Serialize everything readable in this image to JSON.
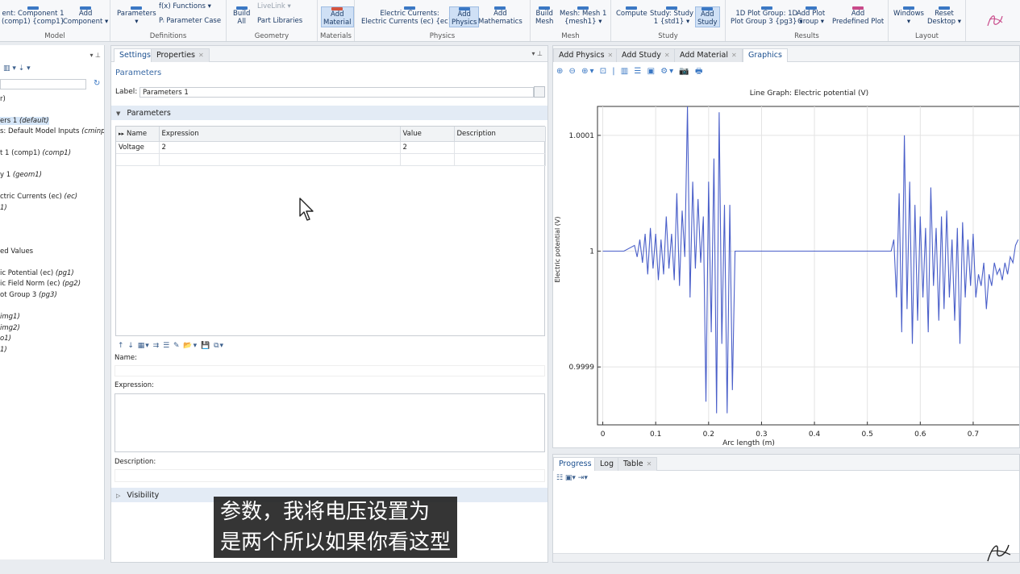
{
  "ribbon": {
    "groups": [
      {
        "title": "Model",
        "buttons": [
          "ent: Component 1\n(comp1) {comp1}",
          "Add\nComponent ▾"
        ]
      },
      {
        "title": "Definitions",
        "buttons": [
          "Parameters\n▾",
          "f(x) Functions ▾",
          "Pᵢ Parameter Case"
        ]
      },
      {
        "title": "Geometry",
        "buttons": [
          "Build\nAll",
          "LiveLink ▾",
          "Part Libraries"
        ]
      },
      {
        "title": "Materials",
        "buttons": [
          "Add\nMaterial"
        ]
      },
      {
        "title": "Physics",
        "buttons": [
          "Electric Currents:\nElectric Currents (ec) {ec} ▾",
          "Add\nPhysics",
          "Add\nMathematics"
        ]
      },
      {
        "title": "Mesh",
        "buttons": [
          "Build\nMesh",
          "Mesh: Mesh 1\n{mesh1} ▾"
        ]
      },
      {
        "title": "Study",
        "buttons": [
          "Compute",
          "Study: Study\n1 {std1} ▾",
          "Add\nStudy"
        ]
      },
      {
        "title": "Results",
        "buttons": [
          "1D Plot Group: 1D\nPlot Group 3 {pg3} ▾",
          "Add Plot\nGroup ▾",
          "Add\nPredefined Plot"
        ]
      },
      {
        "title": "Layout",
        "buttons": [
          "Windows\n▾",
          "Reset\nDesktop ▾"
        ]
      }
    ]
  },
  "tree": {
    "tools": "▥ ▾  ⇣ ▾",
    "items": [
      {
        "text": "r)",
        "italic": "",
        "selected": false
      },
      {
        "text": "ers 1 ",
        "italic": "(default)",
        "selected": true
      },
      {
        "text": "s: Default Model Inputs ",
        "italic": "(cminpt)",
        "selected": false
      },
      {
        "text": "t 1 (comp1) ",
        "italic": "(comp1)",
        "selected": false
      },
      {
        "text": "y 1 ",
        "italic": "(geom1)",
        "selected": false
      },
      {
        "text": "ctric Currents (ec) ",
        "italic": "(ec)",
        "selected": false
      },
      {
        "text": "",
        "italic": "1)",
        "selected": false
      },
      {
        "text": "ed Values",
        "italic": "",
        "selected": false
      },
      {
        "text": "ic Potential (ec) ",
        "italic": "(pg1)",
        "selected": false
      },
      {
        "text": "ic Field Norm (ec) ",
        "italic": "(pg2)",
        "selected": false
      },
      {
        "text": "ot Group 3 ",
        "italic": "(pg3)",
        "selected": false
      },
      {
        "text": "",
        "italic": "img1)",
        "selected": false
      },
      {
        "text": "",
        "italic": "img2)",
        "selected": false
      },
      {
        "text": "",
        "italic": "o1)",
        "selected": false
      },
      {
        "text": "",
        "italic": "1)",
        "selected": false
      }
    ]
  },
  "settings": {
    "tabs": [
      {
        "label": "Settings",
        "active": true
      },
      {
        "label": "Properties",
        "active": false
      }
    ],
    "title": "Parameters",
    "label_caption": "Label:",
    "label_value": "Parameters 1",
    "section_parameters": "Parameters",
    "table": {
      "columns": [
        "Name",
        "Expression",
        "Value",
        "Description"
      ],
      "rows": [
        [
          "Voltage",
          "2",
          "2",
          ""
        ],
        [
          "",
          "",
          "",
          ""
        ]
      ]
    },
    "table_tools": "↑ ↓ ▦▾ ⇉ ☰ ✎ 📂▾ 💾 ⧉▾",
    "name_caption": "Name:",
    "expression_caption": "Expression:",
    "description_caption": "Description:",
    "section_visibility": "Visibility"
  },
  "graphics": {
    "tabs": [
      {
        "label": "Add Physics",
        "active": false
      },
      {
        "label": "Add Study",
        "active": false
      },
      {
        "label": "Add Material",
        "active": false
      },
      {
        "label": "Graphics",
        "active": true
      }
    ],
    "toolbar": "⊕ ⊖ ⊕▾ ⊡ | ▥ ☰ ▣ ⚙▾ 📷 🖶"
  },
  "progress": {
    "tabs": [
      {
        "label": "Progress",
        "active": true
      },
      {
        "label": "Log",
        "active": false
      },
      {
        "label": "Table",
        "active": false
      }
    ],
    "toolbar": "☷ ▣▾  ⇥▾"
  },
  "subtitle": {
    "line1": "参数，我将电压设置为",
    "line2": "是两个所以如果你看这型"
  },
  "colors": {
    "accent": "#3b78c4",
    "line": "#4a5fc9",
    "ribbon_bg": "#f7f8fa",
    "selection": "#d6e6f8"
  },
  "chart_data": {
    "type": "line",
    "title": "Line Graph: Electric potential (V)",
    "xlabel": "Arc length (m)",
    "ylabel": "Electric potential (V)",
    "xlim": [
      -0.01,
      0.79
    ],
    "ylim": [
      0.99985,
      1.000125
    ],
    "x_ticks": [
      0,
      0.1,
      0.2,
      0.3,
      0.4,
      0.5,
      0.6,
      0.7
    ],
    "x_tick_labels": [
      "0",
      "0.1",
      "0.2",
      "0.3",
      "0.4",
      "0.5",
      "0.6",
      "0.7"
    ],
    "y_ticks": [
      0.9999,
      1,
      1.0001
    ],
    "y_tick_labels": [
      "0.9999",
      "1",
      "1.0001"
    ],
    "grid": true,
    "series": [
      {
        "x": [
          0,
          0.04,
          0.06,
          0.065,
          0.07,
          0.075,
          0.08,
          0.085,
          0.09,
          0.095,
          0.1,
          0.105,
          0.11,
          0.115,
          0.12,
          0.125,
          0.13,
          0.135,
          0.14,
          0.145,
          0.15,
          0.155,
          0.16,
          0.165,
          0.17,
          0.175,
          0.18,
          0.185,
          0.19,
          0.195,
          0.2,
          0.205,
          0.21,
          0.215,
          0.22,
          0.225,
          0.23,
          0.235,
          0.24,
          0.245,
          0.25,
          0.3,
          0.4,
          0.5,
          0.545,
          0.55,
          0.555,
          0.56,
          0.565,
          0.57,
          0.575,
          0.58,
          0.585,
          0.59,
          0.595,
          0.6,
          0.605,
          0.61,
          0.615,
          0.62,
          0.625,
          0.63,
          0.635,
          0.64,
          0.645,
          0.65,
          0.655,
          0.66,
          0.665,
          0.67,
          0.675,
          0.68,
          0.685,
          0.69,
          0.695,
          0.7,
          0.705,
          0.71,
          0.715,
          0.72,
          0.725,
          0.73,
          0.735,
          0.74,
          0.745,
          0.75,
          0.755,
          0.76,
          0.765,
          0.77,
          0.775,
          0.78,
          0.785
        ],
        "y": [
          1.0,
          1.0,
          1.000005,
          0.999995,
          1.00001,
          0.99999,
          1.000015,
          0.99998,
          1.00002,
          0.999985,
          1.000015,
          0.999975,
          1.00001,
          0.99998,
          1.00003,
          0.999985,
          1.000015,
          0.999975,
          1.00005,
          0.99997,
          1.000035,
          0.999995,
          1.00055,
          0.99996,
          1.00006,
          0.999985,
          1.000045,
          0.99999,
          1.00003,
          0.99987,
          1.00006,
          0.99993,
          1.00008,
          0.99986,
          1.00012,
          0.99992,
          1.00004,
          0.99986,
          1.00004,
          0.99988,
          1.0,
          1.0,
          1.0,
          1.0,
          1.0,
          1.00001,
          0.99996,
          1.00005,
          0.99993,
          1.0001,
          0.99995,
          1.00006,
          0.99992,
          1.00004,
          0.99994,
          1.00003,
          0.99996,
          1.00002,
          0.99993,
          1.000055,
          0.99997,
          1.00002,
          0.99994,
          1.00003,
          0.99995,
          1.000035,
          0.99996,
          1.00001,
          0.99994,
          1.00002,
          0.99992,
          1.000025,
          0.99996,
          1.00001,
          0.99997,
          1.000015,
          0.99996,
          0.99998,
          0.99997,
          0.99999,
          0.99995,
          0.99998,
          0.99997,
          0.99999,
          0.99998,
          0.999985,
          0.999975,
          0.99999,
          0.99998,
          0.999995,
          0.99999,
          1.000005,
          1.00001
        ]
      }
    ]
  }
}
